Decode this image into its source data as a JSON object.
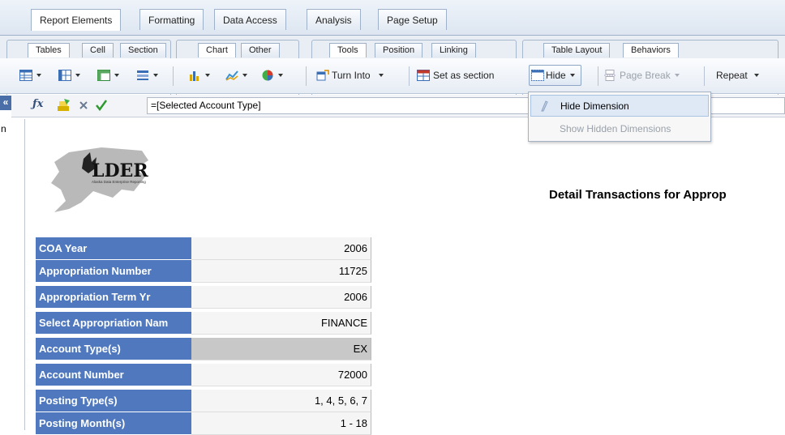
{
  "main_tabs": [
    "Report Elements",
    "Formatting",
    "Data Access",
    "Analysis",
    "Page Setup"
  ],
  "sub_tabs": {
    "group1": [
      "Tables",
      "Cell",
      "Section"
    ],
    "group2": [
      "Chart",
      "Other"
    ],
    "group3": [
      "Tools",
      "Position",
      "Linking"
    ],
    "group4": [
      "Table Layout",
      "Behaviors"
    ]
  },
  "toolbar": {
    "turn_into": "Turn Into",
    "set_as_section": "Set as section",
    "hide": "Hide",
    "page_break": "Page Break",
    "repeat": "Repeat"
  },
  "left_strip": {
    "collapse": "«",
    "letter": "n"
  },
  "formula": {
    "value": "=[Selected Account Type]"
  },
  "menu": {
    "hide_dimension": "Hide Dimension",
    "show_hidden": "Show Hidden Dimensions"
  },
  "logo": {
    "text": "LDER",
    "tagline": "Alaska Data Enterprise Reporting"
  },
  "report": {
    "title": "Detail Transactions for Approp",
    "rows": [
      {
        "label": "COA Year",
        "value": "2006"
      },
      {
        "label": "Appropriation Number",
        "value": "11725"
      },
      {
        "label": "Appropriation Term Yr",
        "value": "2006"
      },
      {
        "label": "Select Appropriation Nam",
        "value": "FINANCE"
      },
      {
        "label": "Account Type(s)",
        "value": "EX"
      },
      {
        "label": "Account Number",
        "value": "72000"
      },
      {
        "label": "Posting Type(s)",
        "value": "1, 4, 5, 6, 7"
      },
      {
        "label": "Posting Month(s)",
        "value": "1 - 18"
      }
    ]
  },
  "colors": {
    "header_blue": "#4f78bf",
    "selected_cell": "#c8c8c8",
    "menu_highlight": "#dfe9f6"
  }
}
